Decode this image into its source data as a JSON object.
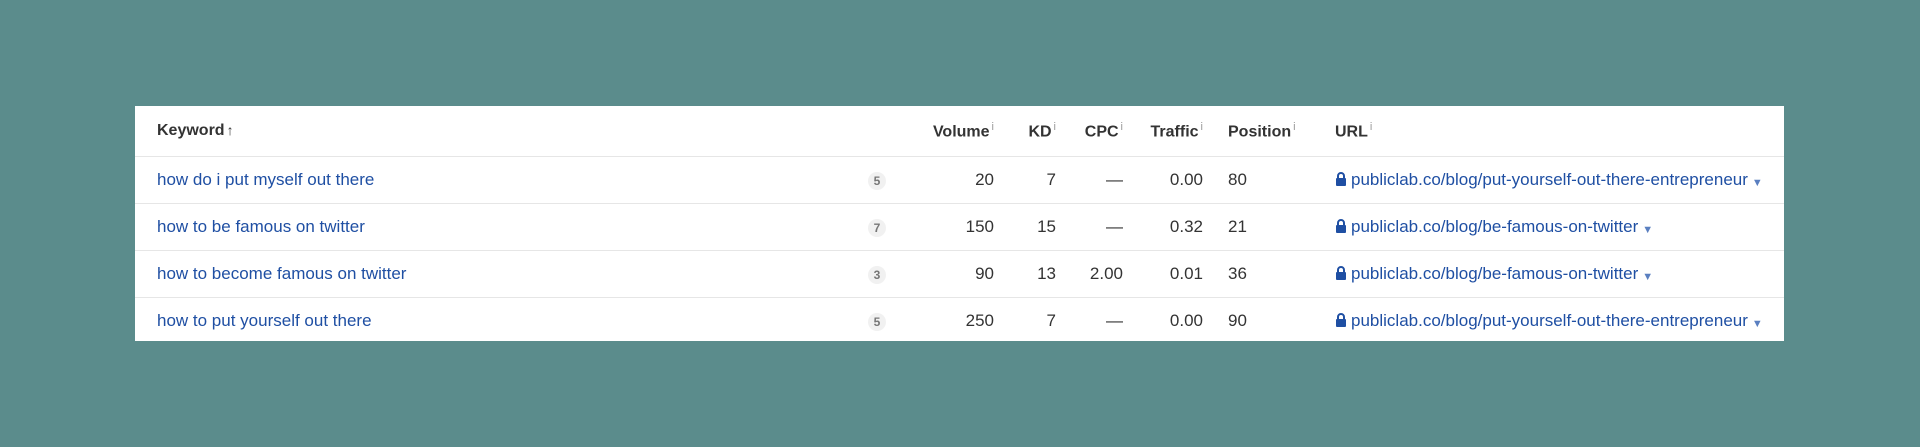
{
  "colors": {
    "background": "#5b8c8c",
    "link": "#1f4fa3",
    "text": "#333333"
  },
  "table": {
    "headers": {
      "keyword": "Keyword",
      "keyword_sort_icon": "arrow-up-icon",
      "volume": "Volume",
      "kd": "KD",
      "cpc": "CPC",
      "traffic": "Traffic",
      "position": "Position",
      "url": "URL",
      "info_marker": "i"
    },
    "rows": [
      {
        "keyword": "how do i put myself out there",
        "serp_count": "5",
        "volume": "20",
        "kd": "7",
        "cpc": "—",
        "traffic": "0.00",
        "position": "80",
        "url": "publiclab.co/blog/put-yourself-out-there-entrepreneur"
      },
      {
        "keyword": "how to be famous on twitter",
        "serp_count": "7",
        "volume": "150",
        "kd": "15",
        "cpc": "—",
        "traffic": "0.32",
        "position": "21",
        "url": "publiclab.co/blog/be-famous-on-twitter"
      },
      {
        "keyword": "how to become famous on twitter",
        "serp_count": "3",
        "volume": "90",
        "kd": "13",
        "cpc": "2.00",
        "traffic": "0.01",
        "position": "36",
        "url": "publiclab.co/blog/be-famous-on-twitter"
      },
      {
        "keyword": "how to put yourself out there",
        "serp_count": "5",
        "volume": "250",
        "kd": "7",
        "cpc": "—",
        "traffic": "0.00",
        "position": "90",
        "url": "publiclab.co/blog/put-yourself-out-there-entrepreneur"
      }
    ]
  }
}
